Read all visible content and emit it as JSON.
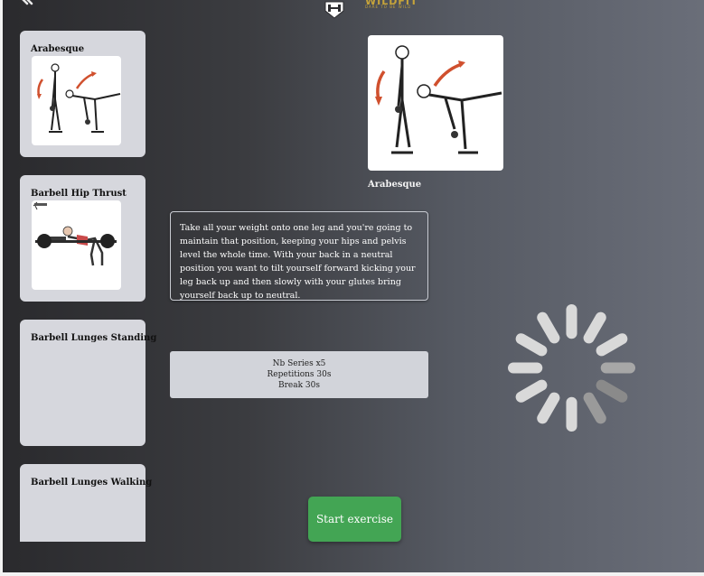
{
  "header": {
    "logo_text": "WILDFIT",
    "logo_tagline": "DARE TO BE WILD"
  },
  "exercise_list": [
    {
      "name": "Arabesque",
      "image": "arabesque-illustration"
    },
    {
      "name": "Barbell Hip Thrust",
      "image": "hip-thrust-illustration"
    },
    {
      "name": "Barbell Lunges Standing",
      "image": ""
    },
    {
      "name": "Barbell Lunges Walking",
      "image": ""
    }
  ],
  "selected": {
    "name": "Arabesque",
    "description": "Take all your weight onto one leg and you're going to maintain that position, keeping your hips and pelvis level the whole time. With your back in a neutral position you want to tilt yourself forward kicking your leg back up and then slowly with your glutes bring yourself back up to neutral.",
    "series": "Nb Series x5",
    "repetitions": "Repetitions 30s",
    "break": "Break 30s"
  },
  "actions": {
    "start_label": "Start exercise"
  },
  "colors": {
    "start_button": "#43a554",
    "card_bg": "#d6d7dd",
    "logo_gold": "#c6a43a"
  },
  "loading_indicator": "spinner-icon"
}
